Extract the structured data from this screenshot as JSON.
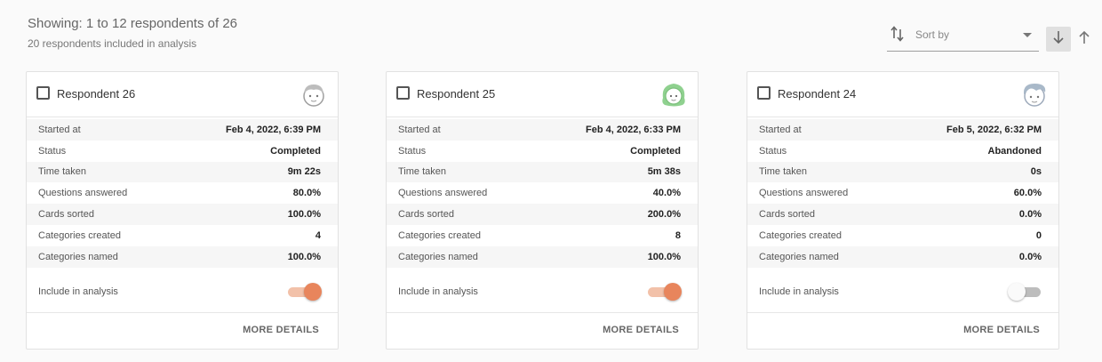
{
  "header": {
    "showing": "Showing: 1 to 12 respondents of 26",
    "included": "20 respondents included in analysis"
  },
  "sort": {
    "placeholder": "Sort by",
    "icon": "sort-arrows-icon",
    "down_icon": "arrow-down-icon",
    "up_icon": "arrow-up-icon"
  },
  "cards": [
    {
      "name": "Respondent 26",
      "avatar_color": "#bdbdbd",
      "rows": [
        {
          "label": "Started at",
          "value": "Feb 4, 2022, 6:39 PM"
        },
        {
          "label": "Status",
          "value": "Completed"
        },
        {
          "label": "Time taken",
          "value": "9m 22s"
        },
        {
          "label": "Questions answered",
          "value": "80.0%"
        },
        {
          "label": "Cards sorted",
          "value": "100.0%"
        },
        {
          "label": "Categories created",
          "value": "4"
        },
        {
          "label": "Categories named",
          "value": "100.0%"
        }
      ],
      "include_label": "Include in analysis",
      "include": true,
      "more": "MORE DETAILS"
    },
    {
      "name": "Respondent 25",
      "avatar_color": "#8fd18f",
      "rows": [
        {
          "label": "Started at",
          "value": "Feb 4, 2022, 6:33 PM"
        },
        {
          "label": "Status",
          "value": "Completed"
        },
        {
          "label": "Time taken",
          "value": "5m 38s"
        },
        {
          "label": "Questions answered",
          "value": "40.0%"
        },
        {
          "label": "Cards sorted",
          "value": "200.0%"
        },
        {
          "label": "Categories created",
          "value": "8"
        },
        {
          "label": "Categories named",
          "value": "100.0%"
        }
      ],
      "include_label": "Include in analysis",
      "include": true,
      "more": "MORE DETAILS"
    },
    {
      "name": "Respondent 24",
      "avatar_color": "#a9b9c9",
      "rows": [
        {
          "label": "Started at",
          "value": "Feb 5, 2022, 6:32 PM"
        },
        {
          "label": "Status",
          "value": "Abandoned"
        },
        {
          "label": "Time taken",
          "value": "0s"
        },
        {
          "label": "Questions answered",
          "value": "60.0%"
        },
        {
          "label": "Cards sorted",
          "value": "0.0%"
        },
        {
          "label": "Categories created",
          "value": "0"
        },
        {
          "label": "Categories named",
          "value": "0.0%"
        }
      ],
      "include_label": "Include in analysis",
      "include": false,
      "more": "MORE DETAILS"
    }
  ]
}
